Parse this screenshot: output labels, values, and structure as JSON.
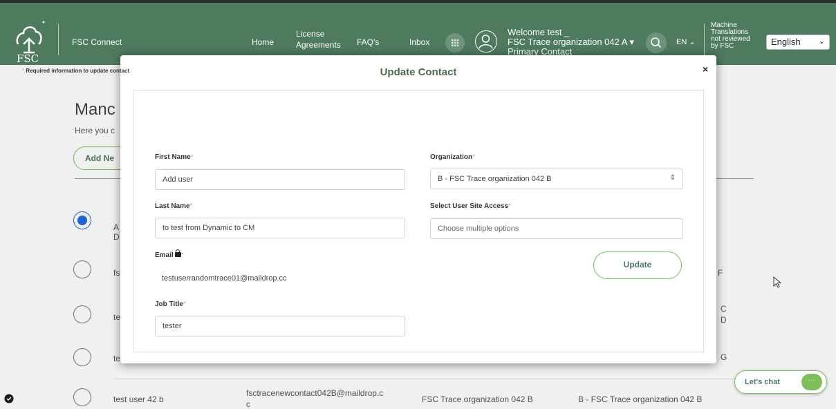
{
  "header": {
    "logo_text": "FSC",
    "brand": "FSC Connect",
    "nav": [
      {
        "id": "home",
        "label": "Home"
      },
      {
        "id": "license-1",
        "label": "License"
      },
      {
        "id": "license-2",
        "label": "Agreements"
      },
      {
        "id": "faq",
        "label": "FAQ's"
      },
      {
        "id": "inbox",
        "label": "Inbox"
      }
    ],
    "welcome_line1": "Welcome test _",
    "welcome_line2": "FSC Trace organization 042 A",
    "welcome_line3": "Primary Contact",
    "lang_code": "EN",
    "machine_note_1": "Machine",
    "machine_note_2": "Translations",
    "machine_note_3": "not reviewed",
    "machine_note_4": "by FSC",
    "language_selected": "English",
    "colors": {
      "header_bg": "#4e7a5e",
      "accent_green": "#7cbf5a"
    }
  },
  "page": {
    "title": "Manc",
    "subtitle": "Here you c",
    "add_button": "Add Ne",
    "rows": [
      {
        "name": "A",
        "name2": "D",
        "org_tail": ""
      },
      {
        "name": "fs",
        "name2": "",
        "org_tail": "F"
      },
      {
        "name": "te",
        "name2": "",
        "org_tail": "C",
        "org_tail2": "D"
      },
      {
        "name": "te",
        "name2": "",
        "org_tail": "G"
      }
    ],
    "last_row": {
      "name": "test user 42 b",
      "email_1": "fsctracenewcontact042B@maildrop.c",
      "email_2": "c",
      "organization": "FSC Trace organization 042 B",
      "site": "B - FSC Trace organization 042 B"
    }
  },
  "modal": {
    "title": "Update Contact",
    "close": "×",
    "required_note": "Required information to update contact",
    "first_name_label": "First Name",
    "first_name_value": "Add user",
    "last_name_label": "Last Name",
    "last_name_value": "to test from Dynamic to CM",
    "email_label": "Email",
    "email_value": "testuserrandomtrace01@maildrop.cc",
    "job_title_label": "Job Title",
    "job_title_value": "tester",
    "organization_label": "Organization",
    "organization_value": "B - FSC Trace organization 042 B",
    "site_access_label": "Select User Site Access",
    "site_access_placeholder": "Choose multiple options",
    "update_button": "Update",
    "star": "*"
  },
  "chat": {
    "label": "Let's chat",
    "bubble": "···"
  }
}
